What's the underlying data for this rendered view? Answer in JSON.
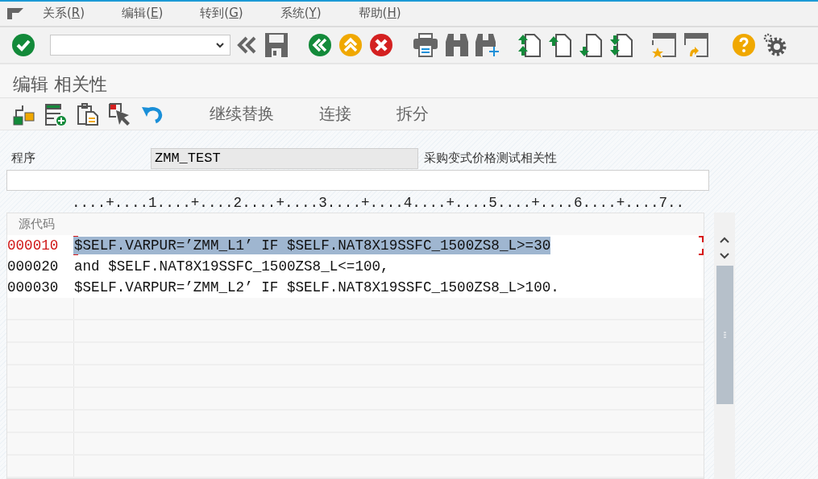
{
  "menu": [
    {
      "label": "关系(R)"
    },
    {
      "label": "编辑(E)"
    },
    {
      "label": "转到(G)"
    },
    {
      "label": "系统(Y)"
    },
    {
      "label": "帮助(H)"
    }
  ],
  "screen_title": "编辑 相关性",
  "app_toolbar": {
    "buttons": [
      "继续替换",
      "连接",
      "拆分"
    ]
  },
  "program": {
    "label": "程序",
    "value": "ZMM_TEST",
    "description": "采购变式价格测试相关性"
  },
  "ruler": "....+....1....+....2....+....3....+....4....+....5....+....6....+....7..",
  "editor": {
    "header": "源代码",
    "lines": [
      {
        "number": "000010",
        "text": "$SELF.VARPUR=’ZMM_L1’ IF $SELF.NAT8X19SSFC_1500ZS8_L>=30",
        "selected": true
      },
      {
        "number": "000020",
        "text": "and $SELF.NAT8X19SSFC_1500ZS8_L<=100,",
        "selected": false
      },
      {
        "number": "000030",
        "text": "$SELF.VARPUR=’ZMM_L2’ IF $SELF.NAT8X19SSFC_1500ZS8_L>100.",
        "selected": false
      }
    ]
  }
}
